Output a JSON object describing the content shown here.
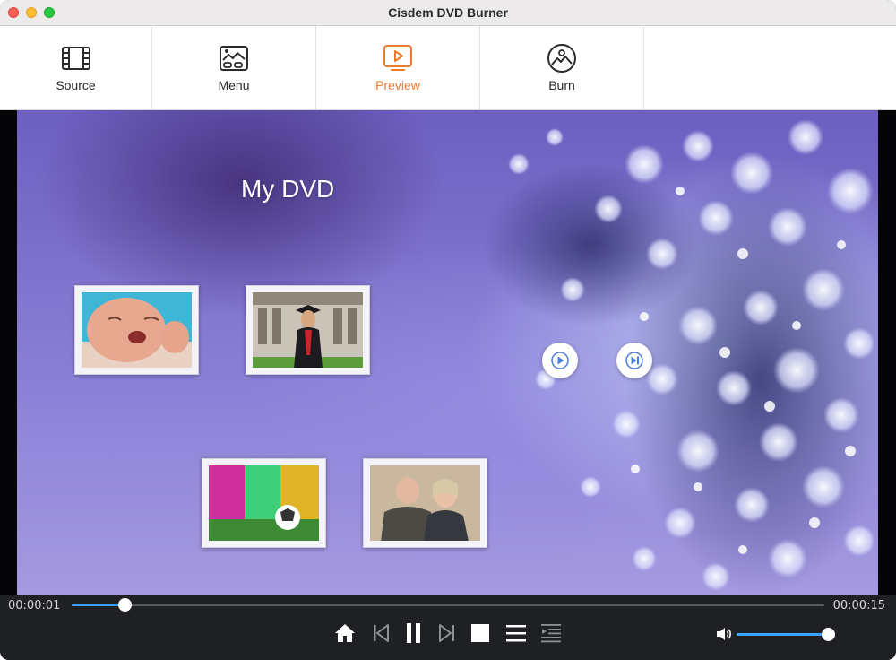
{
  "window": {
    "title": "Cisdem DVD Burner"
  },
  "toolbar": {
    "tabs": [
      {
        "label": "Source",
        "icon": "film-icon"
      },
      {
        "label": "Menu",
        "icon": "menu-template-icon"
      },
      {
        "label": "Preview",
        "icon": "preview-play-icon",
        "active": true
      },
      {
        "label": "Burn",
        "icon": "disc-burn-icon"
      }
    ],
    "active_color": "#ee7a2f"
  },
  "preview": {
    "dvd_title": "My DVD",
    "thumbnails": [
      {
        "subject": "crying baby"
      },
      {
        "subject": "graduate in cap and gown"
      },
      {
        "subject": "soccer ball on field"
      },
      {
        "subject": "smiling couple"
      }
    ],
    "buttons": [
      "play-all",
      "next-page"
    ]
  },
  "player": {
    "current_time": "00:00:01",
    "total_time": "00:00:15",
    "progress": 0.07,
    "volume": 1.0,
    "accent_color": "#3aa3ff",
    "controls": [
      "home",
      "previous",
      "pause",
      "next",
      "stop",
      "menu-list",
      "chapter-list"
    ]
  }
}
